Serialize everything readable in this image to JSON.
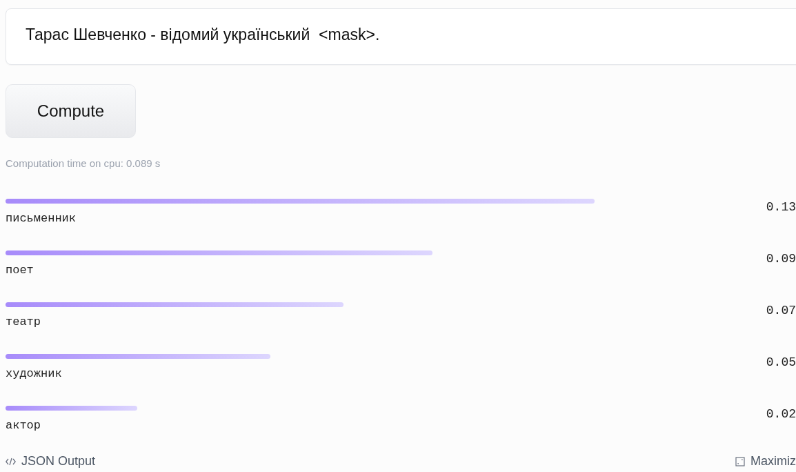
{
  "input": {
    "value": "Тарас Шевченко - відомий український  <mask>."
  },
  "compute_button": {
    "label": "Compute"
  },
  "timing": "Computation time on cpu: 0.089 s",
  "results": [
    {
      "label": "письменник",
      "score": "0.13"
    },
    {
      "label": "поет",
      "score": "0.09"
    },
    {
      "label": "театр",
      "score": "0.07"
    },
    {
      "label": "художник",
      "score": "0.05"
    },
    {
      "label": "актор",
      "score": "0.02"
    }
  ],
  "footer": {
    "json_output": "JSON Output",
    "maximize": "Maximiz"
  }
}
